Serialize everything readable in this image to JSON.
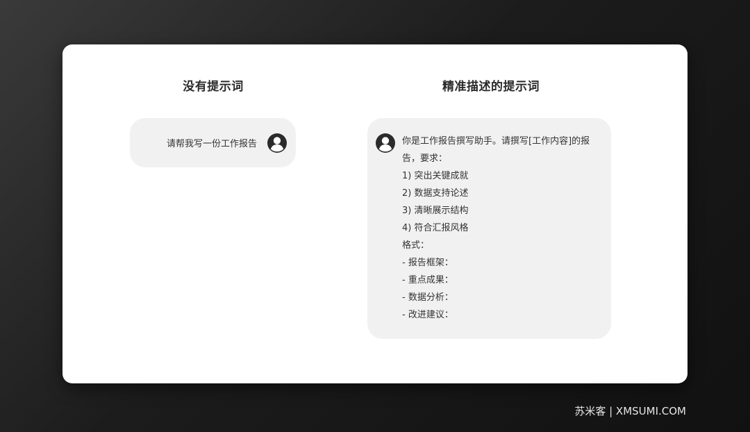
{
  "left": {
    "title": "没有提示词",
    "message": "请帮我写一份工作报告"
  },
  "right": {
    "title": "精准描述的提示词",
    "lines": [
      "你是工作报告撰写助手。请撰写[工作内容]的报",
      "告，要求：",
      "1) 突出关键成就",
      "2) 数据支持论述",
      "3) 清晰展示结构",
      "4) 符合汇报风格",
      "格式：",
      "- 报告框架：",
      "- 重点成果：",
      "- 数据分析：",
      "- 改进建议："
    ]
  },
  "avatar_icon": "user-avatar-icon",
  "watermark": "苏米客 | XMSUMI.COM"
}
